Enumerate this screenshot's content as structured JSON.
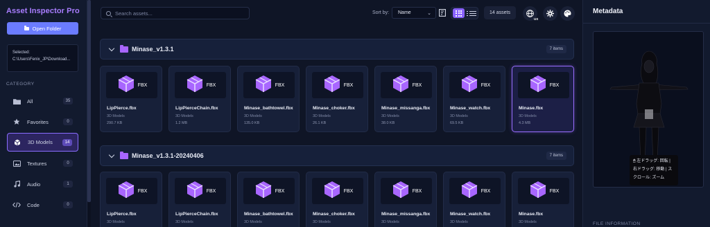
{
  "sidebar": {
    "brand": "Asset Inspector Pro",
    "open_folder": "Open Folder",
    "selected_label": "Selected:",
    "selected_path": "C:\\Users\\Fenix_JP\\Download...",
    "category_title": "CATEGORY",
    "categories": [
      {
        "label": "All",
        "count": "35",
        "icon": "folder-icon"
      },
      {
        "label": "Favorites",
        "count": "0",
        "icon": "star-icon"
      },
      {
        "label": "3D Models",
        "count": "14",
        "icon": "cube-icon"
      },
      {
        "label": "Textures",
        "count": "0",
        "icon": "image-icon"
      },
      {
        "label": "Audio",
        "count": "1",
        "icon": "music-icon"
      },
      {
        "label": "Code",
        "count": "0",
        "icon": "code-icon"
      }
    ]
  },
  "toolbar": {
    "search_placeholder": "Search assets...",
    "sort_label": "Sort by:",
    "sort_value": "Name",
    "assets_count": "14 assets",
    "lang": "US"
  },
  "folders": [
    {
      "name": "Minase_v1.3.1",
      "items_label": "7 items",
      "assets": [
        {
          "name": "LipPierce.fbx",
          "type": "3D Models",
          "size": "290.7 KB"
        },
        {
          "name": "LipPierceChain.fbx",
          "type": "3D Models",
          "size": "1.2 MB"
        },
        {
          "name": "Minase_bathtowel.fbx",
          "type": "3D Models",
          "size": "135.0 KB"
        },
        {
          "name": "Minase_choker.fbx",
          "type": "3D Models",
          "size": "26.1 KB"
        },
        {
          "name": "Minase_missanga.fbx",
          "type": "3D Models",
          "size": "38.0 KB"
        },
        {
          "name": "Minase_watch.fbx",
          "type": "3D Models",
          "size": "69.5 KB"
        },
        {
          "name": "Minase.fbx",
          "type": "3D Models",
          "size": "4.3 MB"
        }
      ]
    },
    {
      "name": "Minase_v1.3.1-20240406",
      "items_label": "7 items",
      "assets": [
        {
          "name": "LipPierce.fbx",
          "type": "3D Models",
          "size": ""
        },
        {
          "name": "LipPierceChain.fbx",
          "type": "3D Models",
          "size": ""
        },
        {
          "name": "Minase_bathtowel.fbx",
          "type": "3D Models",
          "size": ""
        },
        {
          "name": "Minase_choker.fbx",
          "type": "3D Models",
          "size": ""
        },
        {
          "name": "Minase_missanga.fbx",
          "type": "3D Models",
          "size": ""
        },
        {
          "name": "Minase_watch.fbx",
          "type": "3D Models",
          "size": ""
        },
        {
          "name": "Minase.fbx",
          "type": "3D Models",
          "size": ""
        }
      ]
    }
  ],
  "file_badge": "FBX",
  "metadata": {
    "title": "Metadata",
    "hint_line1": "🖱 左ドラッグ: 回転 |",
    "hint_line2": "右ドラッグ: 移動 | ス",
    "hint_line3": "クロール: ズーム",
    "file_info": "FILE INFORMATION"
  },
  "colors": {
    "accent": "#8a63ff",
    "cube": "#a866ff",
    "button": "#6b7cff"
  }
}
